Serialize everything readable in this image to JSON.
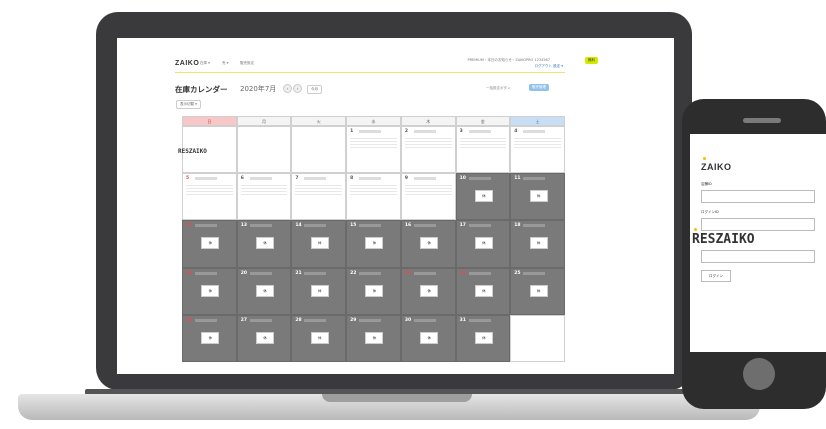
{
  "app": {
    "logo": "ZAIKO",
    "nav": [
      "在庫 ▾",
      "売 ▾",
      "販売設定"
    ],
    "header_right": [
      "PREMIUM・本日のお知らせ・ZAIKOPRO 1234567",
      "ログアウト 設定 ▾"
    ],
    "plan_badge": "無料",
    "page_title": "在庫カレンダー",
    "month_label": "2020年7月",
    "today_button": "今月",
    "filter_label": "表示切替 ▾",
    "action_links": [
      "一括設定ボタン",
      "販売管理"
    ]
  },
  "calendar": {
    "weekdays": [
      "日",
      "月",
      "火",
      "水",
      "木",
      "金",
      "土"
    ],
    "overlay_brand": "RESZAIKO",
    "closed_note": "休",
    "rows": [
      [
        {
          "d": "",
          "t": "blank"
        },
        {
          "d": "",
          "t": "blank"
        },
        {
          "d": "",
          "t": "blank"
        },
        {
          "d": "1",
          "t": "open"
        },
        {
          "d": "2",
          "t": "open"
        },
        {
          "d": "3",
          "t": "open"
        },
        {
          "d": "4",
          "t": "open"
        }
      ],
      [
        {
          "d": "5",
          "t": "open",
          "red": true
        },
        {
          "d": "6",
          "t": "open"
        },
        {
          "d": "7",
          "t": "open"
        },
        {
          "d": "8",
          "t": "open"
        },
        {
          "d": "9",
          "t": "open"
        },
        {
          "d": "10",
          "t": "closed"
        },
        {
          "d": "11",
          "t": "closed"
        }
      ],
      [
        {
          "d": "12",
          "t": "closed",
          "red": true
        },
        {
          "d": "13",
          "t": "closed"
        },
        {
          "d": "14",
          "t": "closed"
        },
        {
          "d": "15",
          "t": "closed"
        },
        {
          "d": "16",
          "t": "closed"
        },
        {
          "d": "17",
          "t": "closed"
        },
        {
          "d": "18",
          "t": "closed"
        }
      ],
      [
        {
          "d": "19",
          "t": "closed",
          "red": true
        },
        {
          "d": "20",
          "t": "closed"
        },
        {
          "d": "21",
          "t": "closed"
        },
        {
          "d": "22",
          "t": "closed"
        },
        {
          "d": "23",
          "t": "closed",
          "red": true
        },
        {
          "d": "24",
          "t": "closed",
          "red": true
        },
        {
          "d": "25",
          "t": "closed"
        }
      ],
      [
        {
          "d": "26",
          "t": "closed",
          "red": true
        },
        {
          "d": "27",
          "t": "closed"
        },
        {
          "d": "28",
          "t": "closed"
        },
        {
          "d": "29",
          "t": "closed"
        },
        {
          "d": "30",
          "t": "closed"
        },
        {
          "d": "31",
          "t": "closed"
        },
        {
          "d": "",
          "t": "blank"
        }
      ]
    ]
  },
  "phone": {
    "logo": "ZAIKO",
    "field1_label": "店舗ID",
    "field2_label": "ログインID",
    "overlay_brand": "RESZAIKO",
    "login_button": "ログイン"
  },
  "colors": {
    "accent": "#f2c200",
    "sunday": "#f9c7c7",
    "saturday": "#c7def5",
    "closed": "#7a7a7a"
  }
}
